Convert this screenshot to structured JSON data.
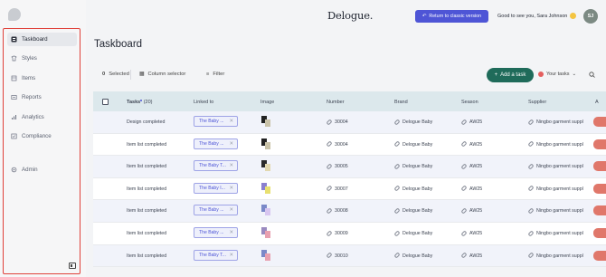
{
  "app": {
    "brand": "Delogue.",
    "classic_button": "Return to classic version",
    "greeting": "Good to see you, Sara Johnson",
    "avatar_initials": "SJ"
  },
  "sidebar": {
    "items": [
      {
        "label": "Taskboard",
        "icon": "taskboard-icon",
        "active": true
      },
      {
        "label": "Styles",
        "icon": "styles-icon",
        "active": false
      },
      {
        "label": "Items",
        "icon": "items-icon",
        "active": false
      },
      {
        "label": "Reports",
        "icon": "reports-icon",
        "active": false
      },
      {
        "label": "Analytics",
        "icon": "analytics-icon",
        "active": false
      },
      {
        "label": "Compliance",
        "icon": "compliance-icon",
        "active": false
      },
      {
        "label": "Admin",
        "icon": "gear-icon",
        "active": false
      }
    ]
  },
  "page": {
    "title": "Taskboard"
  },
  "toolbar": {
    "selected_count": "0",
    "selected_label": "Selected",
    "column_selector": "Column selector",
    "filter": "Filter",
    "add_task": "Add a task",
    "your_tasks": "Your tasks"
  },
  "table": {
    "columns": {
      "tasks": "Tasks",
      "tasks_count": "(20)",
      "linked_to": "Linked to",
      "image": "Image",
      "number": "Number",
      "brand": "Brand",
      "season": "Season",
      "supplier": "Supplier",
      "next": "A"
    },
    "rows": [
      {
        "task": "Design completed",
        "linked": "The Baby ...",
        "number": "30004",
        "brand": "Delogue Baby",
        "season": "AW25",
        "supplier": "Ningbo garment suppl"
      },
      {
        "task": "Item list completed",
        "linked": "The Baby ...",
        "number": "30004",
        "brand": "Delogue Baby",
        "season": "AW25",
        "supplier": "Ningbo garment suppl"
      },
      {
        "task": "Item list completed",
        "linked": "The Baby T...",
        "number": "30005",
        "brand": "Delogue Baby",
        "season": "AW25",
        "supplier": "Ningbo garment suppl"
      },
      {
        "task": "Item list completed",
        "linked": "The Baby I...",
        "number": "30007",
        "brand": "Delogue Baby",
        "season": "AW25",
        "supplier": "Ningbo garment suppl"
      },
      {
        "task": "Item list completed",
        "linked": "The Baby ...",
        "number": "30008",
        "brand": "Delogue Baby",
        "season": "AW25",
        "supplier": "Ningbo garment suppl"
      },
      {
        "task": "Item list completed",
        "linked": "The Baby ...",
        "number": "30009",
        "brand": "Delogue Baby",
        "season": "AW25",
        "supplier": "Ningbo garment suppl"
      },
      {
        "task": "Item list completed",
        "linked": "The Baby T...",
        "number": "30010",
        "brand": "Delogue Baby",
        "season": "AW25",
        "supplier": "Ningbo garment suppl"
      }
    ]
  },
  "colors": {
    "accent": "#4e55d6",
    "primary_green": "#1f6b5a",
    "highlight_red": "#e0413a"
  }
}
